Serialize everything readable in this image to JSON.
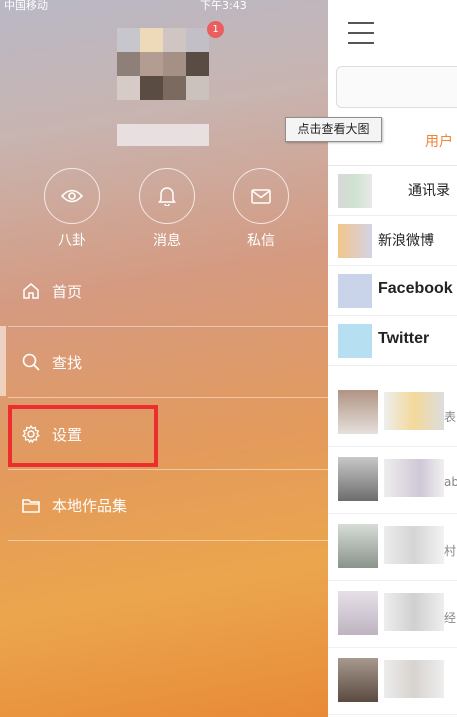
{
  "status_bar": {
    "carrier": "中国移动 ",
    "time": "下午3:43"
  },
  "profile": {
    "badge_count": "1"
  },
  "tooltip": {
    "text": "点击查看大图"
  },
  "quick_actions": [
    {
      "label": "八卦",
      "icon": "eye-icon"
    },
    {
      "label": "消息",
      "icon": "bell-icon"
    },
    {
      "label": "私信",
      "icon": "mail-icon"
    }
  ],
  "menu": [
    {
      "label": "首页",
      "icon": "home-icon"
    },
    {
      "label": "查找",
      "icon": "search-icon"
    },
    {
      "label": "设置",
      "icon": "gear-icon"
    },
    {
      "label": "本地作品集",
      "icon": "folder-icon"
    }
  ],
  "main": {
    "tab_label": "用户",
    "contacts": [
      {
        "label": "通讯录"
      },
      {
        "label": "新浪微博"
      },
      {
        "label": "Facebook"
      },
      {
        "label": "Twitter"
      }
    ],
    "feed_fragments": [
      "表",
      "ab",
      "村",
      "经"
    ]
  },
  "colors": {
    "highlight": "#ec2e2e",
    "accent": "#f0843a"
  }
}
